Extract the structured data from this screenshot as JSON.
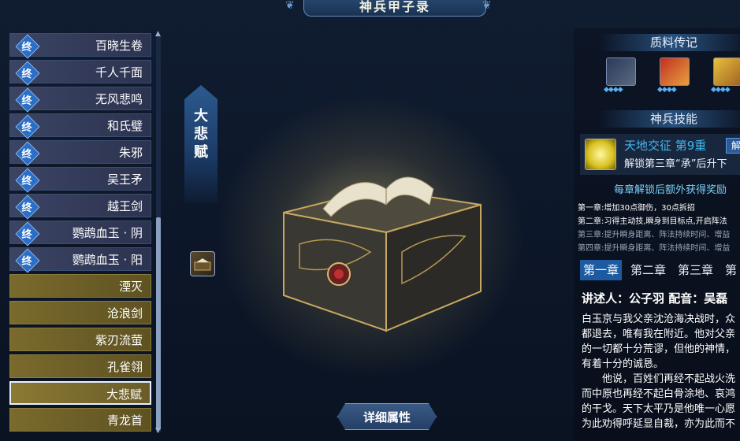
{
  "header": {
    "title": "神兵甲子录"
  },
  "sidebar": {
    "items": [
      {
        "badge": "终",
        "label": "百晓生卷",
        "style": "purple"
      },
      {
        "badge": "终",
        "label": "千人千面",
        "style": "purple"
      },
      {
        "badge": "终",
        "label": "无风悲鸣",
        "style": "purple"
      },
      {
        "badge": "终",
        "label": "和氏璧",
        "style": "purple"
      },
      {
        "badge": "终",
        "label": "朱邪",
        "style": "purple"
      },
      {
        "badge": "终",
        "label": "吴王矛",
        "style": "purple"
      },
      {
        "badge": "终",
        "label": "越王剑",
        "style": "purple"
      },
      {
        "badge": "终",
        "label": "鹦鹉血玉 · 阴",
        "style": "purple"
      },
      {
        "badge": "终",
        "label": "鹦鹉血玉 · 阳",
        "style": "purple"
      },
      {
        "badge": "",
        "label": "湮灭",
        "style": "gold"
      },
      {
        "badge": "",
        "label": "沧浪剑",
        "style": "gold"
      },
      {
        "badge": "",
        "label": "紫刃流萤",
        "style": "gold"
      },
      {
        "badge": "",
        "label": "孔雀翎",
        "style": "gold"
      },
      {
        "badge": "",
        "label": "大悲赋",
        "style": "selected"
      },
      {
        "badge": "",
        "label": "青龙首",
        "style": "gold"
      }
    ]
  },
  "vtab": {
    "title": "大悲赋"
  },
  "detail_button": {
    "label": "详细属性"
  },
  "materials": {
    "title": "质料传记"
  },
  "skill": {
    "section_title": "神兵技能",
    "name": "天地交征 第9重",
    "unlock_tag": "解",
    "desc": "解锁第三章“承”后升下"
  },
  "rewards": {
    "title": "每章解锁后额外获得奖励",
    "lines": [
      {
        "text": "第一章:增加30点御伤，30点拆招",
        "color": "#ffffff"
      },
      {
        "text": "第二章:习得主动技,瞬身到目标点,开启阵法",
        "color": "#ffffff"
      },
      {
        "text": "第三章:提升瞬身距离、阵法持续时间、增益",
        "color": "#9aa6b8"
      },
      {
        "text": "第四章:提升瞬身距离、阵法持续时间、增益",
        "color": "#9aa6b8"
      }
    ]
  },
  "chapter_tabs": [
    "第一章",
    "第二章",
    "第三章",
    "第"
  ],
  "narration": "讲述人：公子羽 配音：吴磊",
  "story": [
    "白玉京与我父亲沈沧海决战时，众",
    "都退去，唯有我在附近。他对父亲",
    "的一切都十分荒谬，但他的神情，",
    "有着十分的诚恳。",
    "　　他说，百姓们再经不起战火洗",
    "而中原也再经不起白骨涂地、哀鸿",
    "的干戈。天下太平乃是他唯一心愿",
    "为此劝得呼延显自裁，亦为此而不"
  ],
  "colors": {
    "accent": "#1e5aa0",
    "skill_name": "#40b8f0",
    "reward_title": "#7ad0f8"
  }
}
